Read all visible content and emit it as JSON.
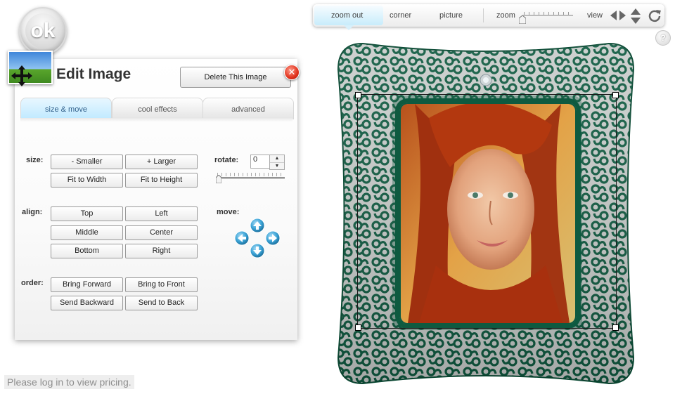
{
  "ok_button": {
    "label": "ok"
  },
  "edit_panel": {
    "title": "Edit Image",
    "delete_label": "Delete This Image",
    "close_symbol": "✕",
    "tabs": [
      {
        "label": "size & move",
        "active": true
      },
      {
        "label": "cool effects",
        "active": false
      },
      {
        "label": "advanced",
        "active": false
      }
    ],
    "size": {
      "label": "size:",
      "smaller": "- Smaller",
      "larger": "+ Larger",
      "fit_width": "Fit to Width",
      "fit_height": "Fit to Height"
    },
    "rotate": {
      "label": "rotate:",
      "value": "0",
      "slider_value": 0
    },
    "align": {
      "label": "align:",
      "top": "Top",
      "left": "Left",
      "middle": "Middle",
      "center": "Center",
      "bottom": "Bottom",
      "right": "Right"
    },
    "move": {
      "label": "move:"
    },
    "order": {
      "label": "order:",
      "bring_forward": "Bring Forward",
      "bring_to_front": "Bring to Front",
      "send_backward": "Send Backward",
      "send_to_back": "Send to Back"
    }
  },
  "toolbar": {
    "zoom_out": "zoom out",
    "corner": "corner",
    "picture": "picture",
    "zoom": "zoom",
    "view": "view",
    "zoom_value": 0,
    "help": "?"
  },
  "pricing_note": "Please log in to view pricing.",
  "icons": {
    "move_cross": "move-cross-icon",
    "image": "image-icon",
    "flip_horizontal": "flip-horizontal-icon",
    "flip_vertical": "flip-vertical-icon",
    "rotate": "rotate-icon"
  },
  "colors": {
    "frame_green": "#0e5a40",
    "tab_active": "#bfe9ff",
    "close_red": "#e0321c"
  }
}
